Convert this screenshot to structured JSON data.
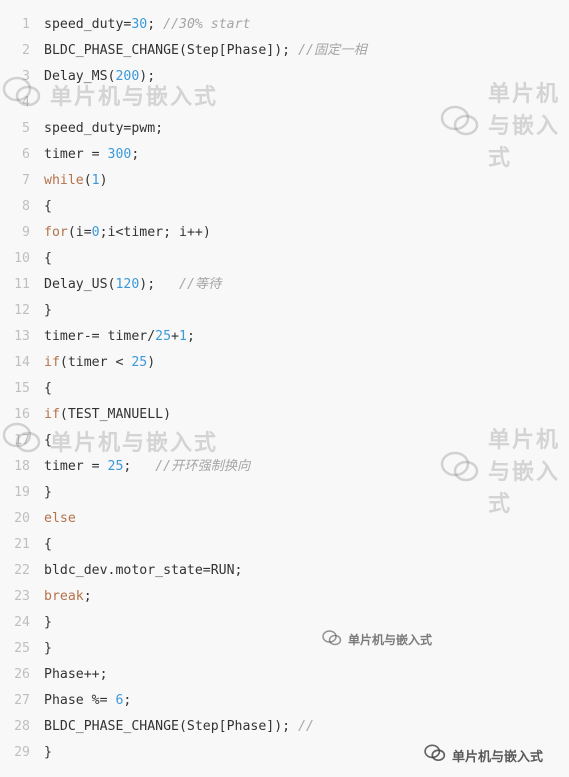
{
  "lines": [
    {
      "n": "1",
      "tokens": [
        {
          "t": "speed_duty="
        },
        {
          "t": "30",
          "c": "num"
        },
        {
          "t": "; "
        },
        {
          "t": "//30% start",
          "c": "cm"
        }
      ]
    },
    {
      "n": "2",
      "tokens": [
        {
          "t": "BLDC_PHASE_CHANGE(Step[Phase]); "
        },
        {
          "t": "//固定一相",
          "c": "cm"
        }
      ]
    },
    {
      "n": "3",
      "tokens": [
        {
          "t": "Delay_MS("
        },
        {
          "t": "200",
          "c": "num"
        },
        {
          "t": ");"
        }
      ]
    },
    {
      "n": "4",
      "tokens": []
    },
    {
      "n": "5",
      "tokens": [
        {
          "t": "speed_duty=pwm;"
        }
      ]
    },
    {
      "n": "6",
      "tokens": [
        {
          "t": "timer = "
        },
        {
          "t": "300",
          "c": "num"
        },
        {
          "t": ";"
        }
      ]
    },
    {
      "n": "7",
      "tokens": [
        {
          "t": "while",
          "c": "kw"
        },
        {
          "t": "("
        },
        {
          "t": "1",
          "c": "num"
        },
        {
          "t": ")"
        }
      ]
    },
    {
      "n": "8",
      "tokens": [
        {
          "t": "{"
        }
      ]
    },
    {
      "n": "9",
      "tokens": [
        {
          "t": "for",
          "c": "kw"
        },
        {
          "t": "(i="
        },
        {
          "t": "0",
          "c": "num"
        },
        {
          "t": ";i<timer; i++)"
        }
      ]
    },
    {
      "n": "10",
      "tokens": [
        {
          "t": "{"
        }
      ]
    },
    {
      "n": "11",
      "tokens": [
        {
          "t": "Delay_US("
        },
        {
          "t": "120",
          "c": "num"
        },
        {
          "t": ");   "
        },
        {
          "t": "//等待",
          "c": "cm"
        }
      ]
    },
    {
      "n": "12",
      "tokens": [
        {
          "t": "}"
        }
      ]
    },
    {
      "n": "13",
      "tokens": [
        {
          "t": "timer-= timer/"
        },
        {
          "t": "25",
          "c": "num"
        },
        {
          "t": "+"
        },
        {
          "t": "1",
          "c": "num"
        },
        {
          "t": ";"
        }
      ]
    },
    {
      "n": "14",
      "tokens": [
        {
          "t": "if",
          "c": "kw"
        },
        {
          "t": "(timer < "
        },
        {
          "t": "25",
          "c": "num"
        },
        {
          "t": ")"
        }
      ]
    },
    {
      "n": "15",
      "tokens": [
        {
          "t": "{"
        }
      ]
    },
    {
      "n": "16",
      "tokens": [
        {
          "t": "if",
          "c": "kw"
        },
        {
          "t": "(TEST_MANUELL)"
        }
      ]
    },
    {
      "n": "17",
      "tokens": [
        {
          "t": "{"
        }
      ]
    },
    {
      "n": "18",
      "tokens": [
        {
          "t": "timer = "
        },
        {
          "t": "25",
          "c": "num"
        },
        {
          "t": ";   "
        },
        {
          "t": "//开环强制换向",
          "c": "cm"
        }
      ]
    },
    {
      "n": "19",
      "tokens": [
        {
          "t": "}"
        }
      ]
    },
    {
      "n": "20",
      "tokens": [
        {
          "t": "else",
          "c": "kw"
        }
      ]
    },
    {
      "n": "21",
      "tokens": [
        {
          "t": "{"
        }
      ]
    },
    {
      "n": "22",
      "tokens": [
        {
          "t": "bldc_dev.motor_state=RUN;"
        }
      ]
    },
    {
      "n": "23",
      "tokens": [
        {
          "t": "break",
          "c": "kw"
        },
        {
          "t": ";"
        }
      ]
    },
    {
      "n": "24",
      "tokens": [
        {
          "t": "}"
        }
      ]
    },
    {
      "n": "25",
      "tokens": [
        {
          "t": "}"
        }
      ]
    },
    {
      "n": "26",
      "tokens": [
        {
          "t": "Phase++;"
        }
      ]
    },
    {
      "n": "27",
      "tokens": [
        {
          "t": "Phase %= "
        },
        {
          "t": "6",
          "c": "num"
        },
        {
          "t": ";"
        }
      ]
    },
    {
      "n": "28",
      "tokens": [
        {
          "t": "BLDC_PHASE_CHANGE(Step[Phase]); "
        },
        {
          "t": "//",
          "c": "cm"
        }
      ]
    },
    {
      "n": "29",
      "tokens": [
        {
          "t": "}"
        }
      ]
    }
  ],
  "watermark": {
    "text": "单片机与嵌入式",
    "icon": "wechat-icon"
  }
}
